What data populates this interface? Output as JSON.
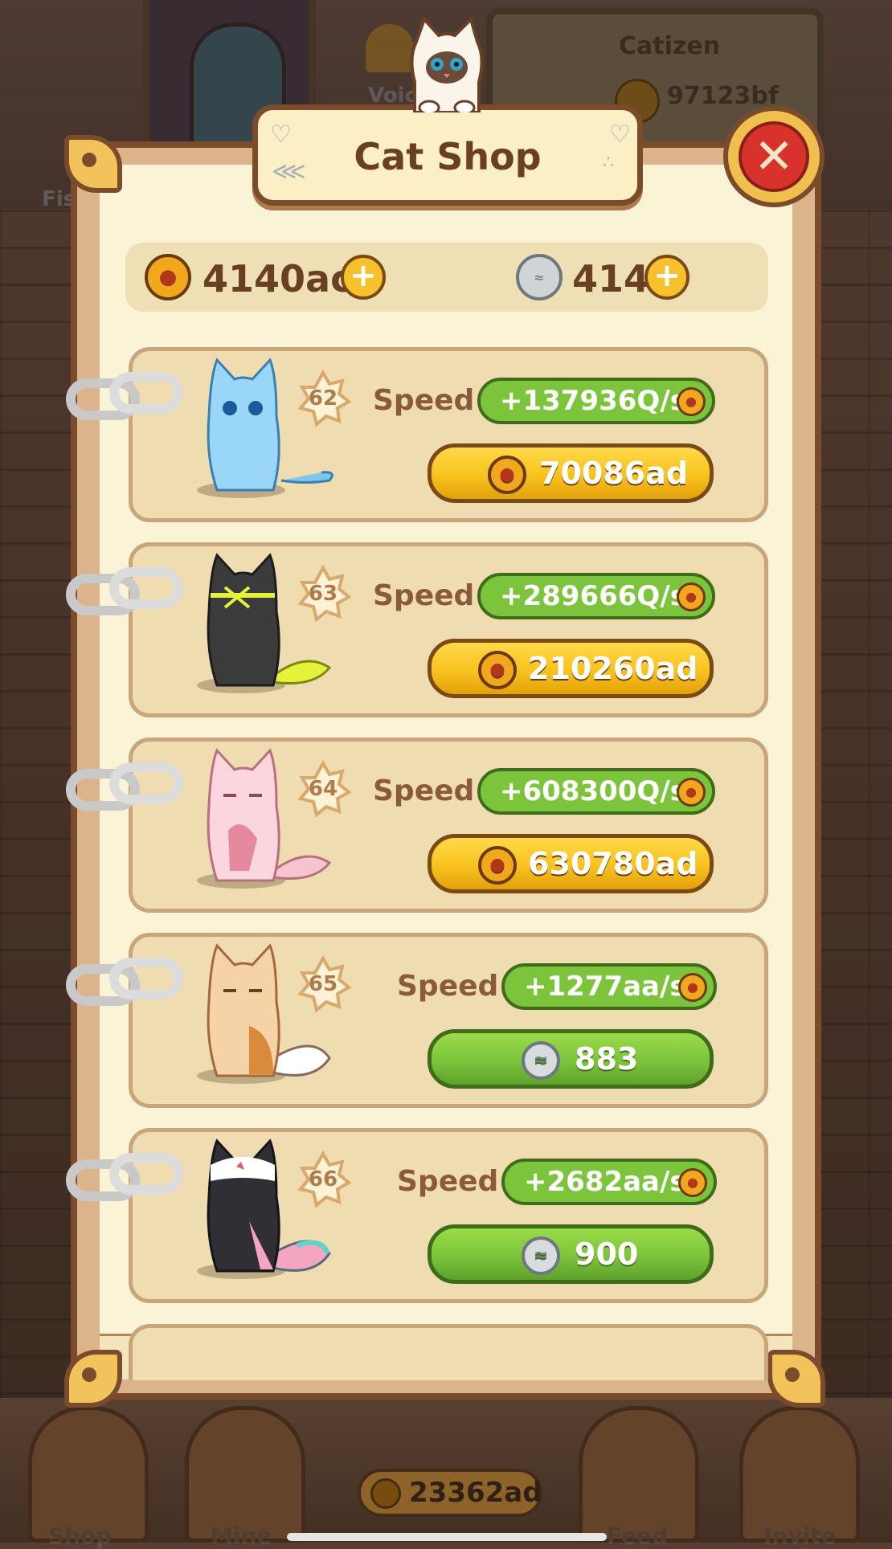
{
  "background": {
    "voice_label": "Voic",
    "fish_label": "Fis",
    "catizen_title": "Catizen",
    "catizen_balance": "97123bf",
    "bottom_balance": "23362ad",
    "nav": [
      "Shop",
      "Mine",
      "Feed",
      "Invite"
    ]
  },
  "modal": {
    "title": "Cat Shop",
    "close_icon": "close-x-icon"
  },
  "currency": {
    "coins": "4140ac",
    "fish": "414",
    "coin_icon": "paw-coin-icon",
    "fish_icon": "fish-coin-icon"
  },
  "speed_label": "Speed",
  "cats": [
    {
      "level": "62",
      "speed": "+137936Q/s",
      "price": "70086ad",
      "currency": "coin"
    },
    {
      "level": "63",
      "speed": "+289666Q/s",
      "price": "210260ad",
      "currency": "coin"
    },
    {
      "level": "64",
      "speed": "+608300Q/s",
      "price": "630780ad",
      "currency": "coin"
    },
    {
      "level": "65",
      "speed": "+1277aa/s",
      "price": "883",
      "currency": "fish"
    },
    {
      "level": "66",
      "speed": "+2682aa/s",
      "price": "900",
      "currency": "fish"
    }
  ],
  "colors": {
    "panel": "#fbf3d6",
    "frame": "#7b4c2c",
    "speed_pill": "#7cc43b",
    "buy_gold": "#f8c21d",
    "buy_green": "#7cc43b",
    "close_red": "#d7322c"
  }
}
